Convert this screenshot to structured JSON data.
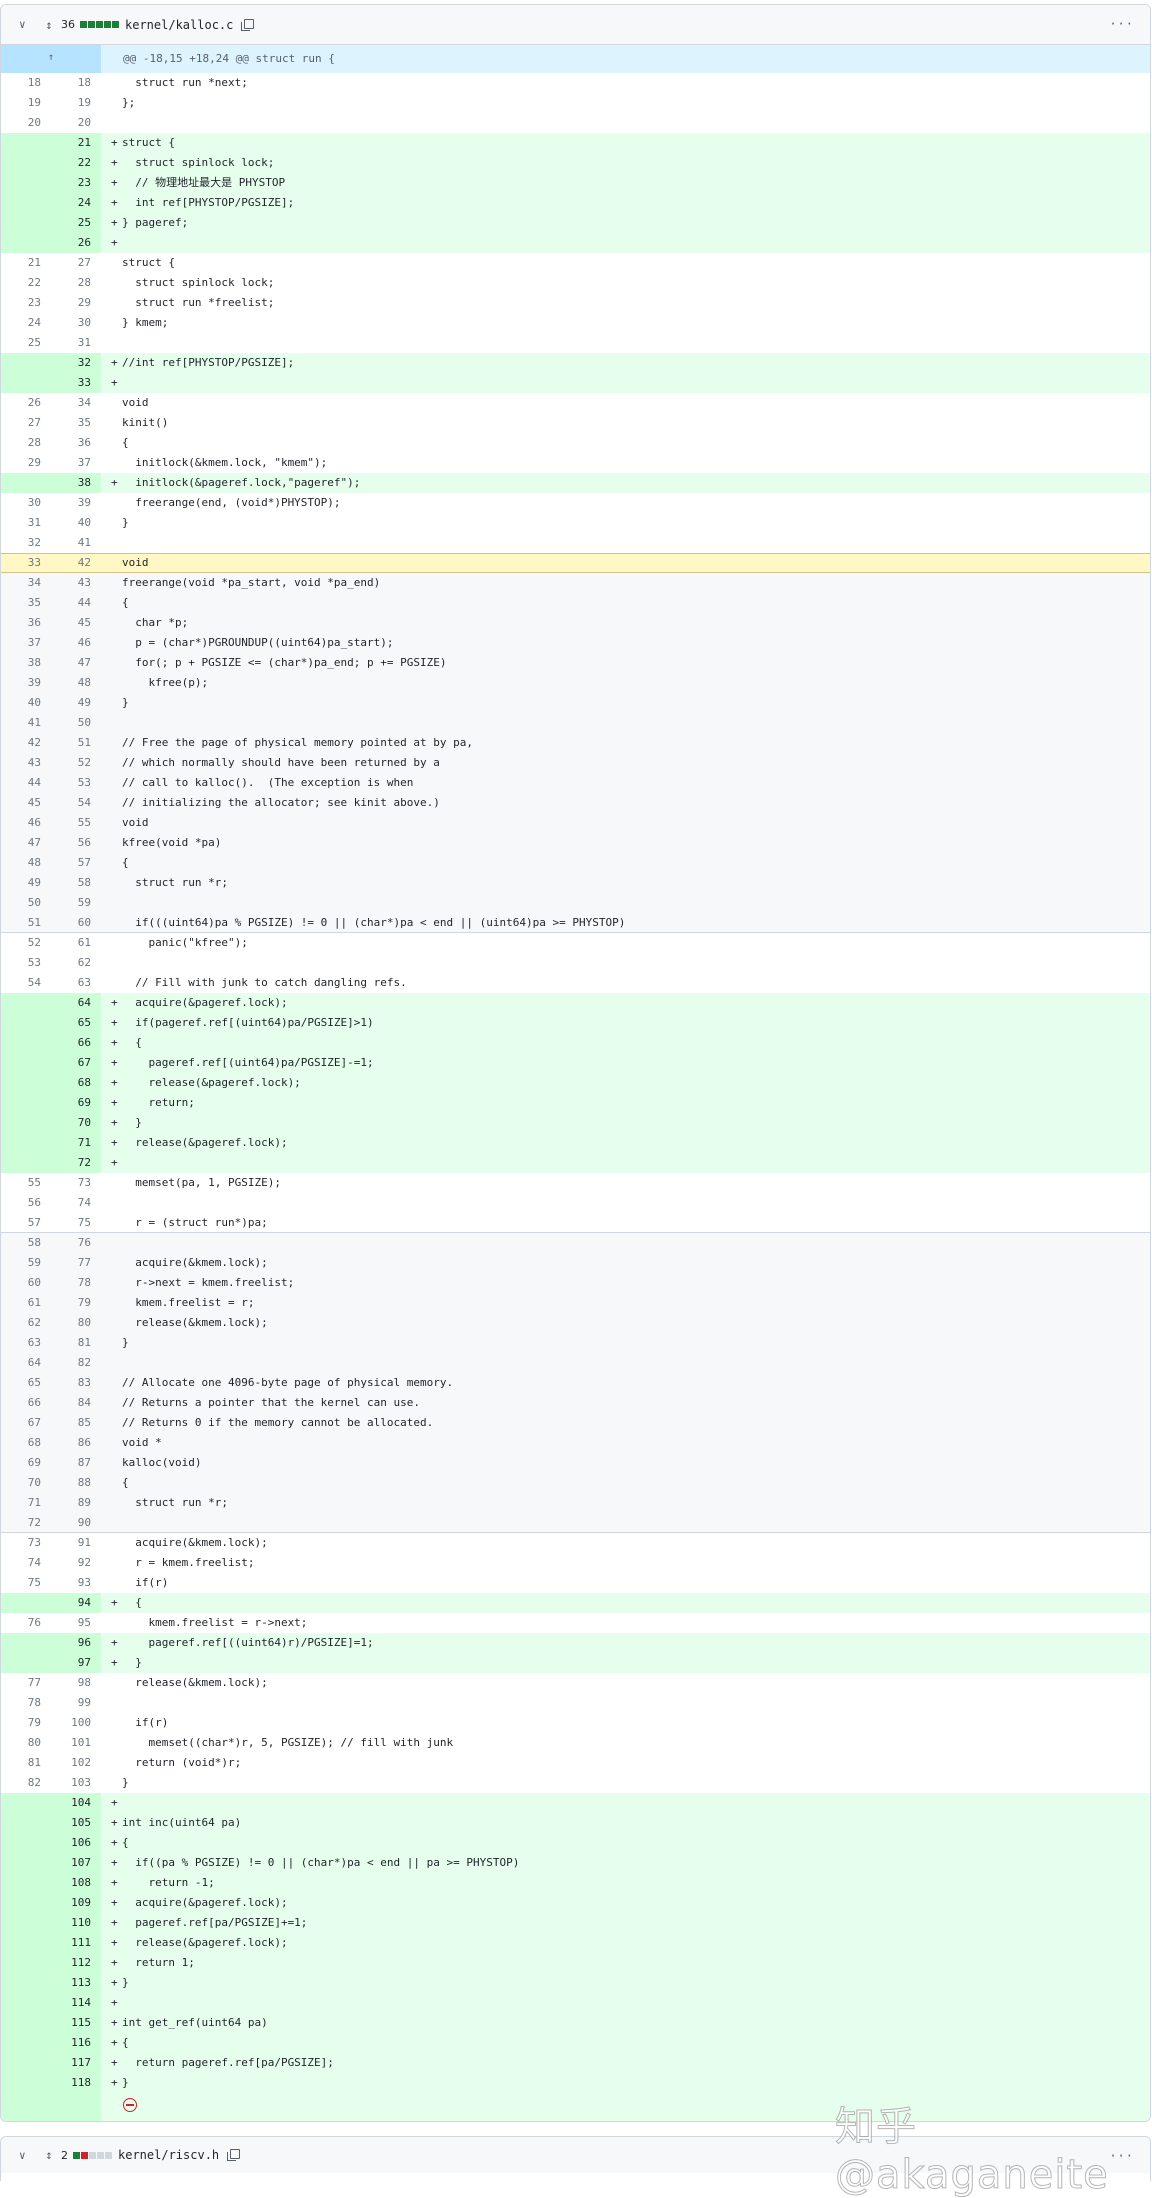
{
  "file1": {
    "count": "36",
    "name": "kernel/kalloc.c",
    "bar": [
      "#1a7f37",
      "#1a7f37",
      "#1a7f37",
      "#1a7f37",
      "#1a7f37"
    ],
    "more": "···",
    "hunk": "@@ -18,15 +18,24 @@ struct run {"
  },
  "file2": {
    "count": "2",
    "name": "kernel/riscv.h",
    "bar": [
      "#1a7f37",
      "#cf222e",
      "#d0d7de",
      "#d0d7de",
      "#d0d7de"
    ],
    "more": "···"
  },
  "watermark": "知乎 @akaganeite",
  "rows": [
    [
      "18",
      "18",
      "ctx",
      "  struct run *next;"
    ],
    [
      "19",
      "19",
      "ctx",
      "};"
    ],
    [
      "20",
      "20",
      "ctx",
      ""
    ],
    [
      "",
      "21",
      "add",
      "struct {"
    ],
    [
      "",
      "22",
      "add",
      "  struct spinlock lock;"
    ],
    [
      "",
      "23",
      "add",
      "  // 物理地址最大是 PHYSTOP"
    ],
    [
      "",
      "24",
      "add",
      "  int ref[PHYSTOP/PGSIZE];"
    ],
    [
      "",
      "25",
      "add",
      "} pageref;"
    ],
    [
      "",
      "26",
      "add",
      ""
    ],
    [
      "21",
      "27",
      "ctx",
      "struct {"
    ],
    [
      "22",
      "28",
      "ctx",
      "  struct spinlock lock;"
    ],
    [
      "23",
      "29",
      "ctx",
      "  struct run *freelist;"
    ],
    [
      "24",
      "30",
      "ctx",
      "} kmem;"
    ],
    [
      "25",
      "31",
      "ctx",
      ""
    ],
    [
      "",
      "32",
      "add",
      "//int ref[PHYSTOP/PGSIZE];"
    ],
    [
      "",
      "33",
      "add",
      ""
    ],
    [
      "26",
      "34",
      "ctx",
      "void"
    ],
    [
      "27",
      "35",
      "ctx",
      "kinit()"
    ],
    [
      "28",
      "36",
      "ctx",
      "{"
    ],
    [
      "29",
      "37",
      "ctx",
      "  initlock(&kmem.lock, \"kmem\");"
    ],
    [
      "",
      "38",
      "add",
      "  initlock(&pageref.lock,\"pageref\");"
    ],
    [
      "30",
      "39",
      "ctx",
      "  freerange(end, (void*)PHYSTOP);"
    ],
    [
      "31",
      "40",
      "ctx",
      "}"
    ],
    [
      "32",
      "41",
      "ctx",
      ""
    ],
    [
      "33",
      "42",
      "hl",
      "void"
    ],
    [
      "34",
      "43",
      "grey",
      "freerange(void *pa_start, void *pa_end)"
    ],
    [
      "35",
      "44",
      "grey",
      "{"
    ],
    [
      "36",
      "45",
      "grey",
      "  char *p;"
    ],
    [
      "37",
      "46",
      "grey",
      "  p = (char*)PGROUNDUP((uint64)pa_start);"
    ],
    [
      "38",
      "47",
      "grey",
      "  for(; p + PGSIZE <= (char*)pa_end; p += PGSIZE)"
    ],
    [
      "39",
      "48",
      "grey",
      "    kfree(p);"
    ],
    [
      "40",
      "49",
      "grey",
      "}"
    ],
    [
      "41",
      "50",
      "grey",
      ""
    ],
    [
      "42",
      "51",
      "grey",
      "// Free the page of physical memory pointed at by pa,"
    ],
    [
      "43",
      "52",
      "grey",
      "// which normally should have been returned by a"
    ],
    [
      "44",
      "53",
      "grey",
      "// call to kalloc().  (The exception is when"
    ],
    [
      "45",
      "54",
      "grey",
      "// initializing the allocator; see kinit above.)"
    ],
    [
      "46",
      "55",
      "grey",
      "void"
    ],
    [
      "47",
      "56",
      "grey",
      "kfree(void *pa)"
    ],
    [
      "48",
      "57",
      "grey",
      "{"
    ],
    [
      "49",
      "58",
      "grey",
      "  struct run *r;"
    ],
    [
      "50",
      "59",
      "grey",
      ""
    ],
    [
      "51",
      "60",
      "grey bb",
      "  if(((uint64)pa % PGSIZE) != 0 || (char*)pa < end || (uint64)pa >= PHYSTOP)"
    ],
    [
      "52",
      "61",
      "ctx",
      "    panic(\"kfree\");"
    ],
    [
      "53",
      "62",
      "ctx",
      ""
    ],
    [
      "54",
      "63",
      "ctx",
      "  // Fill with junk to catch dangling refs."
    ],
    [
      "",
      "64",
      "add",
      "  acquire(&pageref.lock);"
    ],
    [
      "",
      "65",
      "add",
      "  if(pageref.ref[(uint64)pa/PGSIZE]>1)"
    ],
    [
      "",
      "66",
      "add",
      "  {"
    ],
    [
      "",
      "67",
      "add",
      "    pageref.ref[(uint64)pa/PGSIZE]-=1;"
    ],
    [
      "",
      "68",
      "add",
      "    release(&pageref.lock);"
    ],
    [
      "",
      "69",
      "add",
      "    return;"
    ],
    [
      "",
      "70",
      "add",
      "  }"
    ],
    [
      "",
      "71",
      "add",
      "  release(&pageref.lock);"
    ],
    [
      "",
      "72",
      "add",
      ""
    ],
    [
      "55",
      "73",
      "ctx",
      "  memset(pa, 1, PGSIZE);"
    ],
    [
      "56",
      "74",
      "ctx",
      ""
    ],
    [
      "57",
      "75",
      "ctx bb",
      "  r = (struct run*)pa;"
    ],
    [
      "58",
      "76",
      "grey",
      ""
    ],
    [
      "59",
      "77",
      "grey",
      "  acquire(&kmem.lock);"
    ],
    [
      "60",
      "78",
      "grey",
      "  r->next = kmem.freelist;"
    ],
    [
      "61",
      "79",
      "grey",
      "  kmem.freelist = r;"
    ],
    [
      "62",
      "80",
      "grey",
      "  release(&kmem.lock);"
    ],
    [
      "63",
      "81",
      "grey",
      "}"
    ],
    [
      "64",
      "82",
      "grey",
      ""
    ],
    [
      "65",
      "83",
      "grey",
      "// Allocate one 4096-byte page of physical memory."
    ],
    [
      "66",
      "84",
      "grey",
      "// Returns a pointer that the kernel can use."
    ],
    [
      "67",
      "85",
      "grey",
      "// Returns 0 if the memory cannot be allocated."
    ],
    [
      "68",
      "86",
      "grey",
      "void *"
    ],
    [
      "69",
      "87",
      "grey",
      "kalloc(void)"
    ],
    [
      "70",
      "88",
      "grey",
      "{"
    ],
    [
      "71",
      "89",
      "grey",
      "  struct run *r;"
    ],
    [
      "72",
      "90",
      "grey bb",
      ""
    ],
    [
      "73",
      "91",
      "ctx",
      "  acquire(&kmem.lock);"
    ],
    [
      "74",
      "92",
      "ctx",
      "  r = kmem.freelist;"
    ],
    [
      "75",
      "93",
      "ctx",
      "  if(r)"
    ],
    [
      "",
      "94",
      "add",
      "  {"
    ],
    [
      "76",
      "95",
      "ctx",
      "    kmem.freelist = r->next;"
    ],
    [
      "",
      "96",
      "add",
      "    pageref.ref[((uint64)r)/PGSIZE]=1;"
    ],
    [
      "",
      "97",
      "add",
      "  }"
    ],
    [
      "77",
      "98",
      "ctx",
      "  release(&kmem.lock);"
    ],
    [
      "78",
      "99",
      "ctx",
      ""
    ],
    [
      "79",
      "100",
      "ctx",
      "  if(r)"
    ],
    [
      "80",
      "101",
      "ctx",
      "    memset((char*)r, 5, PGSIZE); // fill with junk"
    ],
    [
      "81",
      "102",
      "ctx",
      "  return (void*)r;"
    ],
    [
      "82",
      "103",
      "ctx",
      "}"
    ],
    [
      "",
      "104",
      "add",
      ""
    ],
    [
      "",
      "105",
      "add",
      "int inc(uint64 pa)"
    ],
    [
      "",
      "106",
      "add",
      "{"
    ],
    [
      "",
      "107",
      "add",
      "  if((pa % PGSIZE) != 0 || (char*)pa < end || pa >= PHYSTOP)"
    ],
    [
      "",
      "108",
      "add",
      "    return -1;"
    ],
    [
      "",
      "109",
      "add",
      "  acquire(&pageref.lock);"
    ],
    [
      "",
      "110",
      "add",
      "  pageref.ref[pa/PGSIZE]+=1;"
    ],
    [
      "",
      "111",
      "add",
      "  release(&pageref.lock);"
    ],
    [
      "",
      "112",
      "add",
      "  return 1;"
    ],
    [
      "",
      "113",
      "add",
      "}"
    ],
    [
      "",
      "114",
      "add",
      ""
    ],
    [
      "",
      "115",
      "add",
      "int get_ref(uint64 pa)"
    ],
    [
      "",
      "116",
      "add",
      "{"
    ],
    [
      "",
      "117",
      "add",
      "  return pageref.ref[pa/PGSIZE];"
    ],
    [
      "",
      "118",
      "add",
      "}"
    ]
  ]
}
